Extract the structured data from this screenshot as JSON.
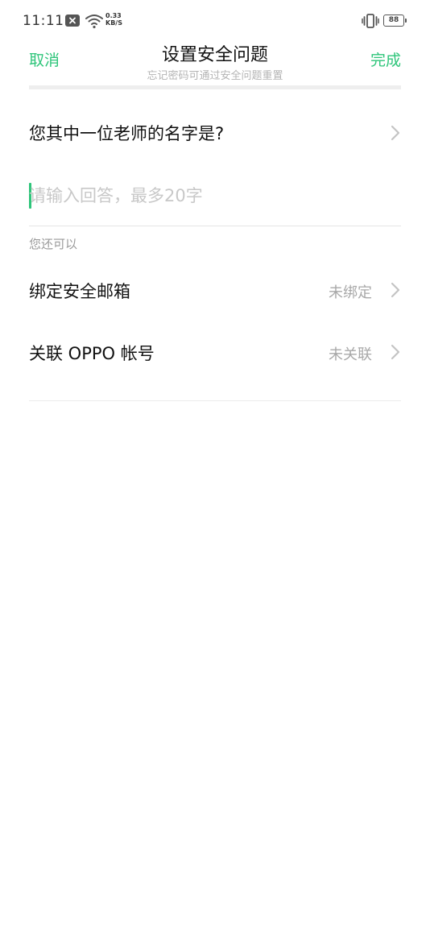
{
  "status_bar": {
    "time": "11:11",
    "net_speed_value": "0.33",
    "net_speed_unit": "KB/S",
    "battery_level": "88",
    "icons": [
      "notification-x-icon",
      "wifi-icon",
      "vibrate-icon",
      "battery-icon"
    ]
  },
  "header": {
    "cancel_label": "取消",
    "title": "设置安全问题",
    "subtitle": "忘记密码可通过安全问题重置",
    "done_label": "完成"
  },
  "question": {
    "text": "您其中一位老师的名字是?"
  },
  "answer": {
    "value": "",
    "placeholder": "请输入回答，最多20字"
  },
  "more_section": {
    "label": "您还可以",
    "options": [
      {
        "label": "绑定安全邮箱",
        "status": "未绑定"
      },
      {
        "label": "关联 OPPO 帐号",
        "status": "未关联"
      }
    ]
  },
  "colors": {
    "accent": "#2ec57a",
    "text_primary": "#111111",
    "text_secondary": "#a8a8a8",
    "placeholder": "#c8c8c8",
    "divider": "#e4e4e4"
  }
}
